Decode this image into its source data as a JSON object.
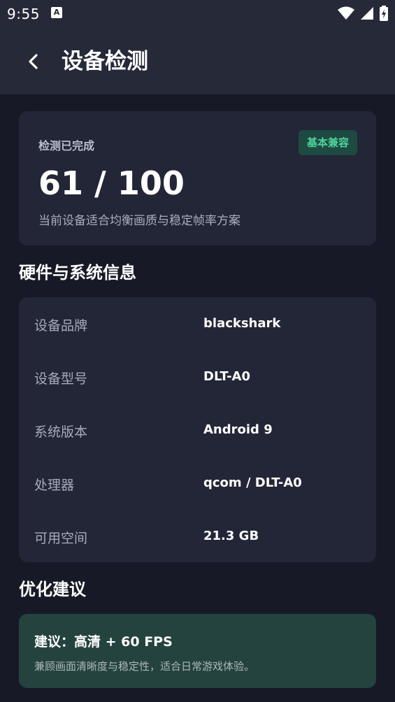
{
  "status_bar": {
    "time": "9:55",
    "notification_icon": "A",
    "icons": [
      "wifi-icon",
      "signal-icon",
      "battery-charging-icon"
    ]
  },
  "header": {
    "back_icon": "chevron-left-icon",
    "title": "设备检测"
  },
  "score_card": {
    "label": "检测已完成",
    "badge": "基本兼容",
    "score": "61 / 100",
    "description": "当前设备适合均衡画质与稳定帧率方案"
  },
  "hardware": {
    "title": "硬件与系统信息",
    "rows": [
      {
        "key": "设备品牌",
        "value": "blackshark"
      },
      {
        "key": "设备型号",
        "value": "DLT-A0"
      },
      {
        "key": "系统版本",
        "value": "Android 9"
      },
      {
        "key": "处理器",
        "value": "qcom / DLT-A0"
      },
      {
        "key": "可用空间",
        "value": "21.3 GB"
      }
    ]
  },
  "optimization": {
    "title": "优化建议",
    "advice_title": "建议：高清 + 60 FPS",
    "advice_desc": "兼顾画面清晰度与稳定性，适合日常游戏体验。"
  },
  "colors": {
    "background": "#171a26",
    "bar": "#262938",
    "card": "#232637",
    "badge_bg": "#1e4a42",
    "badge_text": "#4fd49b",
    "advice_bg": "#24433f"
  }
}
